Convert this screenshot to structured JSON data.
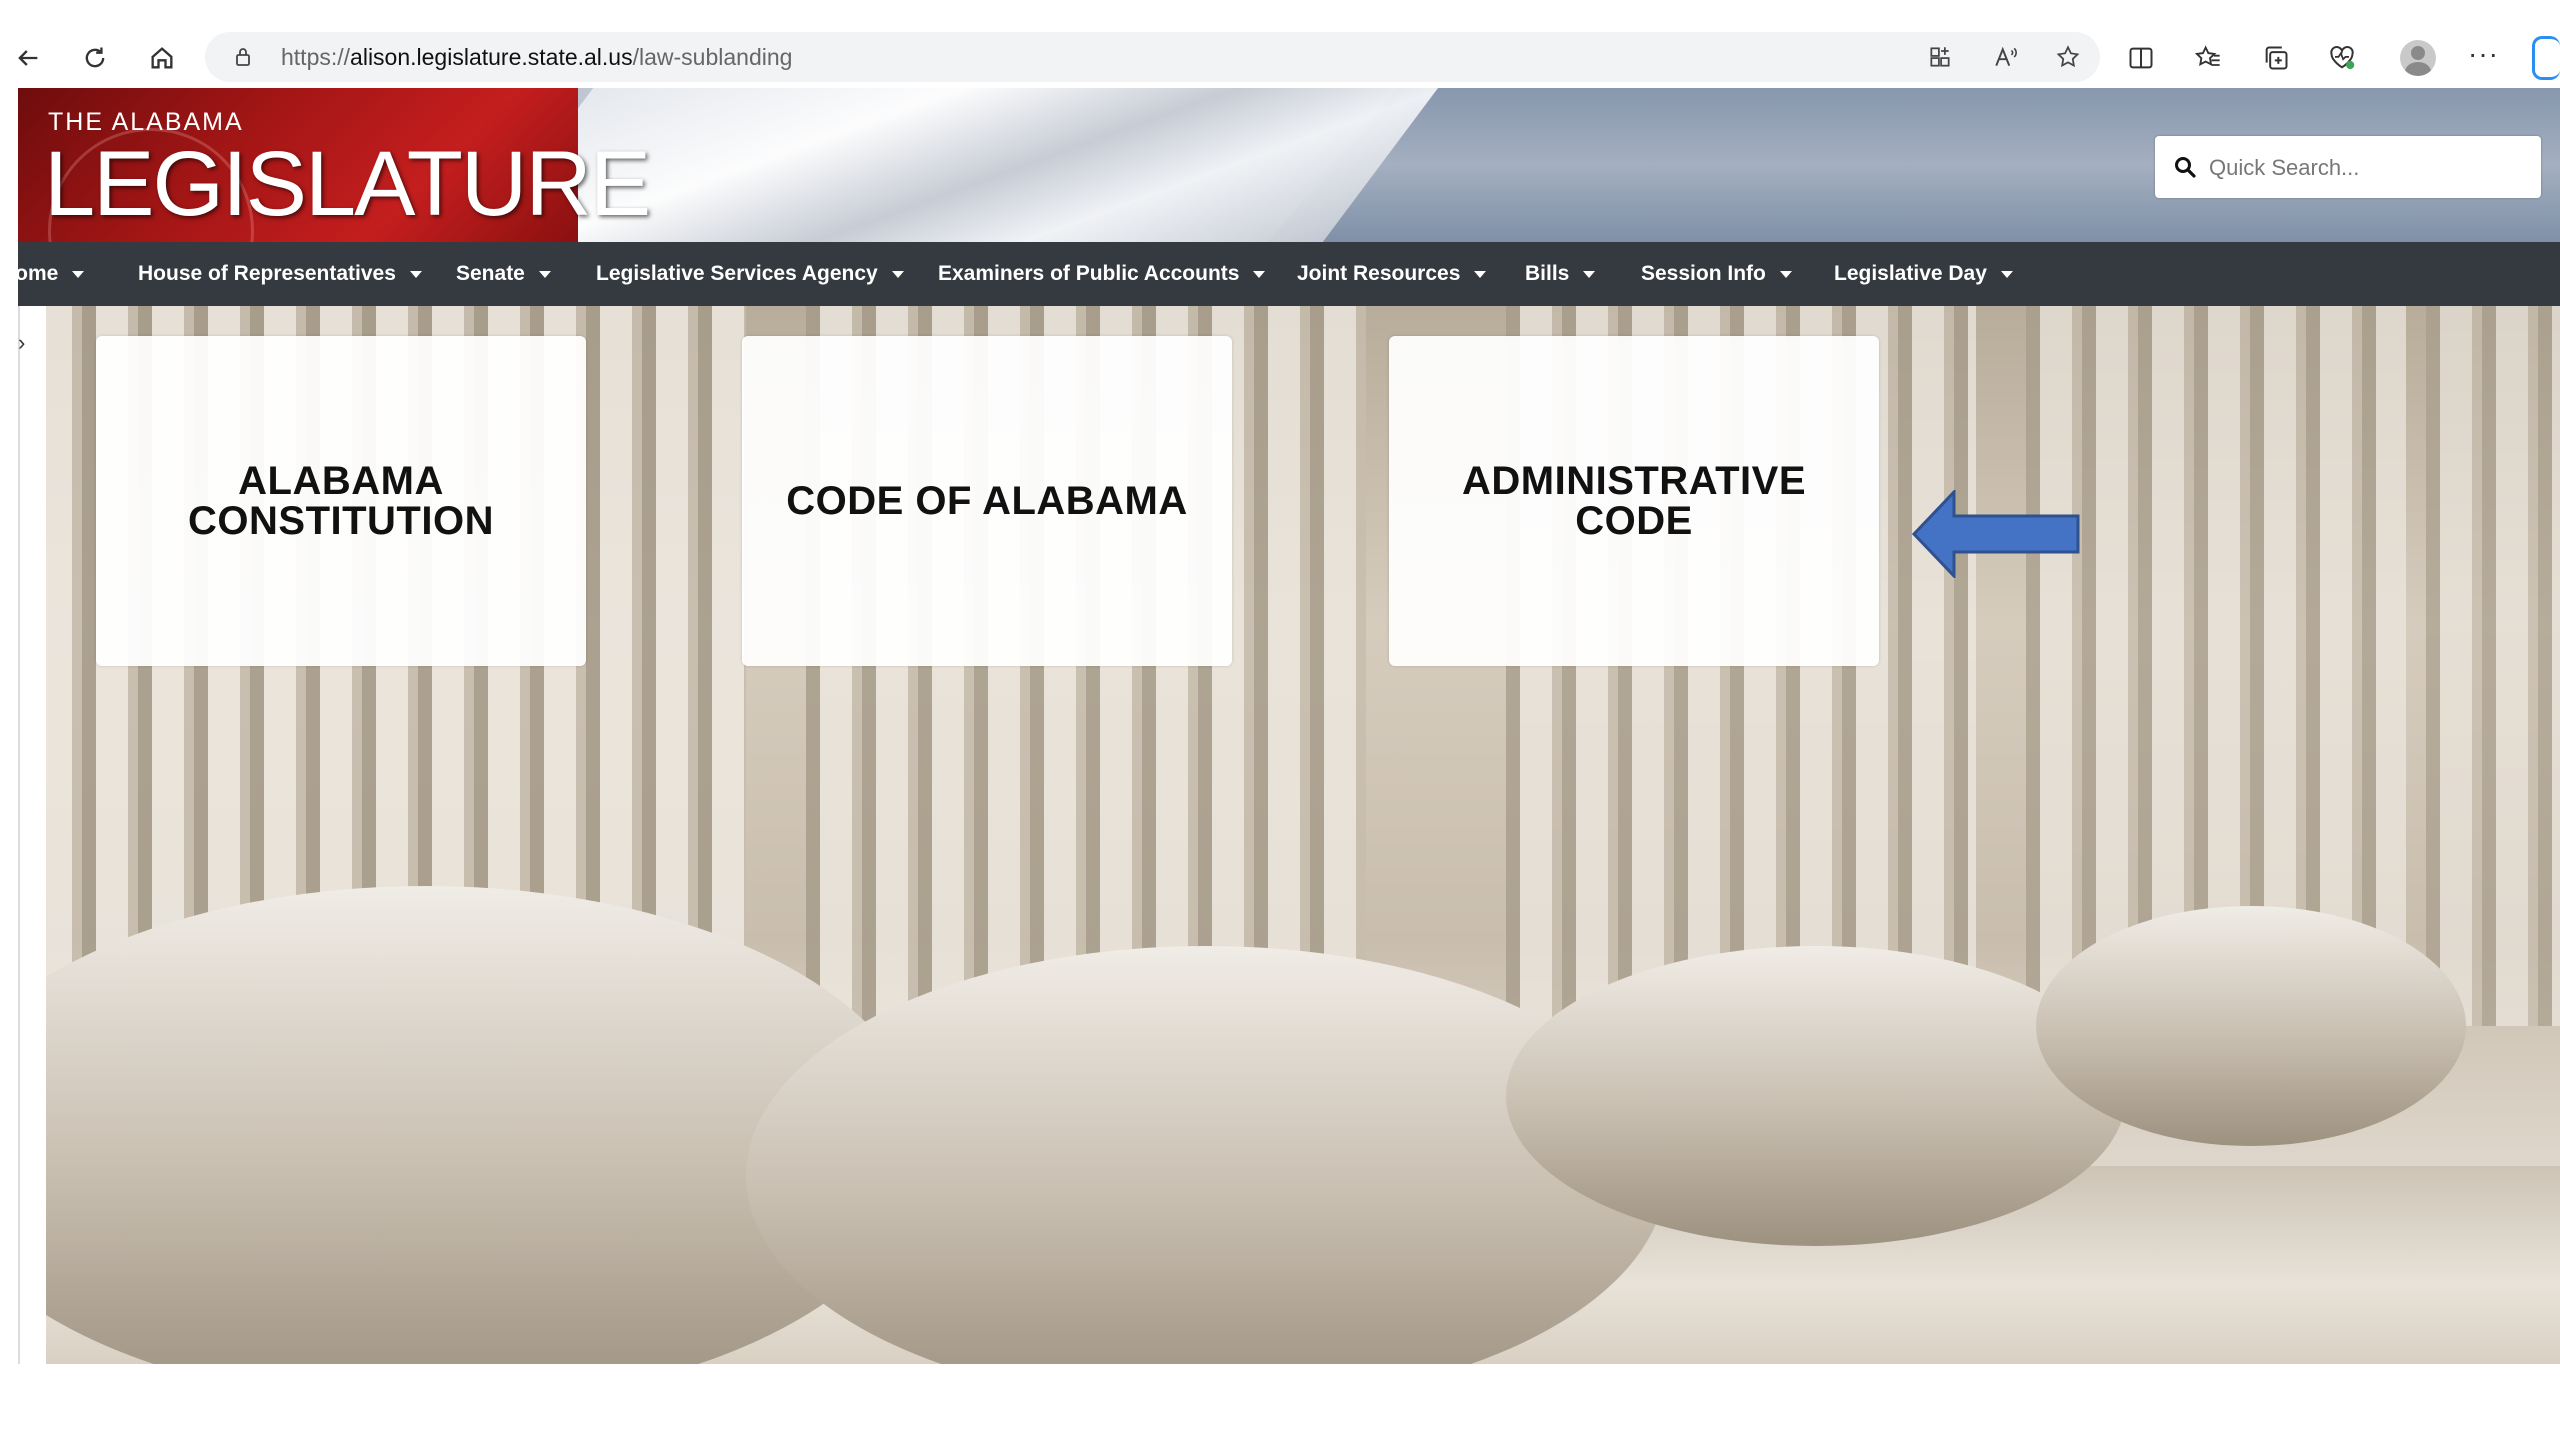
{
  "browser": {
    "url_protocol": "https://",
    "url_host": "alison.legislature.state.al.us",
    "url_path": "/law-sublanding",
    "more_label": "···"
  },
  "header": {
    "logo_small": "THE ALABAMA",
    "logo_big": "LEGISLATURE",
    "search_placeholder": "Quick Search..."
  },
  "nav": {
    "items": [
      {
        "label": "Home"
      },
      {
        "label": "House of Representatives"
      },
      {
        "label": "Senate"
      },
      {
        "label": "Legislative Services Agency"
      },
      {
        "label": "Examiners of Public Accounts"
      },
      {
        "label": "Joint Resources"
      },
      {
        "label": "Bills"
      },
      {
        "label": "Session Info"
      },
      {
        "label": "Legislative Day"
      }
    ]
  },
  "cards": [
    {
      "label": "ALABAMA\nCONSTITUTION"
    },
    {
      "label": "CODE OF ALABAMA"
    },
    {
      "label": "ADMINISTRATIVE\nCODE"
    }
  ],
  "colors": {
    "nav_bg": "#343a40",
    "annotation_arrow": "#4472c4",
    "annotation_arrow_border": "#2f528f"
  },
  "icons": [
    "back-icon",
    "refresh-icon",
    "home-icon",
    "lock-icon",
    "apps-icon",
    "read-aloud-icon",
    "favorite-star-icon",
    "split-screen-icon",
    "favorites-icon",
    "collections-icon",
    "browser-essentials-icon",
    "profile-icon",
    "more-icon",
    "copilot-icon",
    "search-icon",
    "left-arrow-annotation"
  ]
}
